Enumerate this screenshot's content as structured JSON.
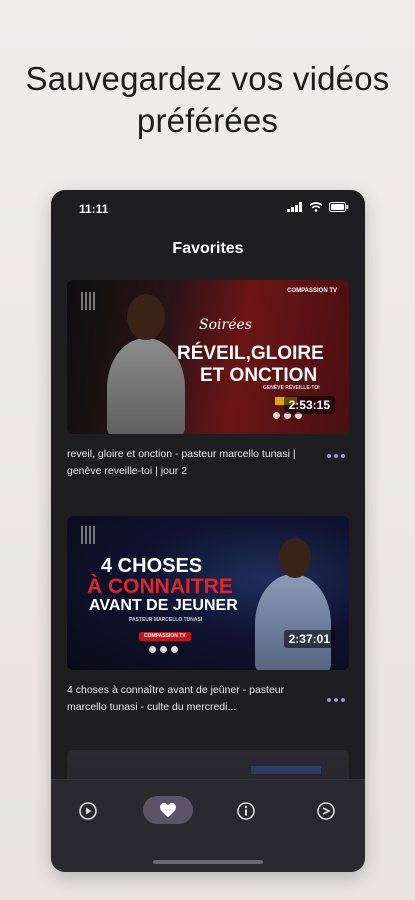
{
  "headline": {
    "line1": "Sauvegardez vos vidéos",
    "line2": "préférées"
  },
  "status_bar": {
    "time": "11:11",
    "icons": [
      "signal-icon",
      "wifi-icon",
      "battery-icon"
    ]
  },
  "screen_title": "Favorites",
  "videos": [
    {
      "thumb_brand": "COMPASSION TV",
      "thumb_series": "Soirées",
      "thumb_title_1": "RÉVEIL,GLOIRE",
      "thumb_title_2": "ET ONCTION",
      "thumb_subtitle": "GENÈVE RÉVEILLE-TOI",
      "duration": "2:53:15",
      "caption": "reveil, gloire et onction - pasteur marcello tunasi | genève reveille-toi | jour 2"
    },
    {
      "thumb_title_1": "4 CHOSES",
      "thumb_title_2": "À CONNAITRE",
      "thumb_title_3": "AVANT DE JEUNER",
      "thumb_subtitle": "PASTEUR MARCELLO TUNASI",
      "thumb_badge": "COMPASSION TV",
      "duration": "2:37:01",
      "caption": "4 choses à connaître avant de jeûner - pasteur marcello tunasi - culte du mercredi..."
    }
  ],
  "tabs": [
    {
      "icon": "play-circle-icon",
      "active": false
    },
    {
      "icon": "heart-icon",
      "active": true
    },
    {
      "icon": "info-circle-icon",
      "active": false
    },
    {
      "icon": "share-circle-icon",
      "active": false
    }
  ],
  "colors": {
    "accent": "#9d8fe0",
    "active_tab_bg": "#5a5466",
    "screen_bg": "#1e1e21",
    "red": "#c0161c"
  }
}
